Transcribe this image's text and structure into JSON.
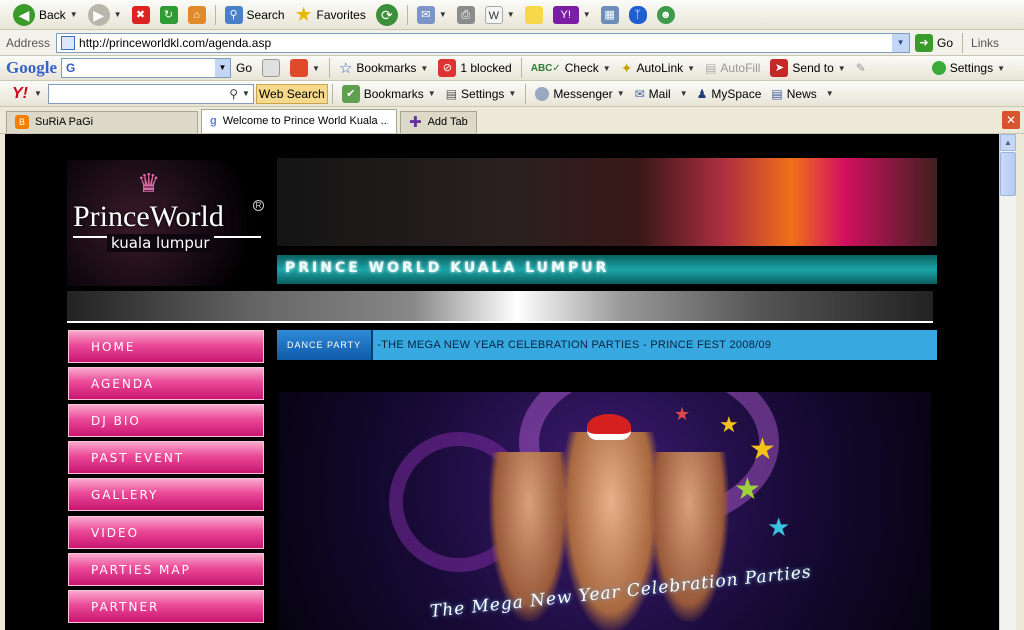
{
  "toolbar": {
    "back": "Back",
    "search": "Search",
    "favorites": "Favorites"
  },
  "address_bar": {
    "label": "Address",
    "url": "http://princeworldkl.com/agenda.asp",
    "go": "Go",
    "links": "Links"
  },
  "google_bar": {
    "brand": "Google",
    "search_input": "G",
    "go": "Go",
    "bookmarks": "Bookmarks",
    "blocked": "1 blocked",
    "check": "Check",
    "autolink": "AutoLink",
    "autofill": "AutoFill",
    "sendto": "Send to",
    "settings": "Settings"
  },
  "yahoo_bar": {
    "brand": "Y!",
    "search_button": "Web Search",
    "bookmarks": "Bookmarks",
    "settings": "Settings",
    "messenger": "Messenger",
    "mail": "Mail",
    "myspace": "MySpace",
    "news": "News"
  },
  "tabs": [
    {
      "label": "SuRiA PaGi",
      "active": false
    },
    {
      "label": "Welcome to Prince World Kuala ...",
      "active": true
    }
  ],
  "add_tab": "Add Tab",
  "site": {
    "logo_name": "PrinceWorld",
    "logo_reg": "R",
    "logo_city": "kuala lumpur",
    "teal_title": "PRINCE WORLD KUALA LUMPUR",
    "menu": [
      "HOME",
      "AGENDA",
      "DJ BIO",
      "PAST EVENT",
      "GALLERY",
      "VIDEO",
      "PARTIES MAP",
      "PARTNER"
    ],
    "ticker_badge": "DANCE PARTY",
    "ticker_text": "-THE MEGA NEW YEAR CELEBRATION PARTIES - PRINCE FEST 2008/09",
    "poster_caption": "The Mega New Year Celebration Parties"
  }
}
